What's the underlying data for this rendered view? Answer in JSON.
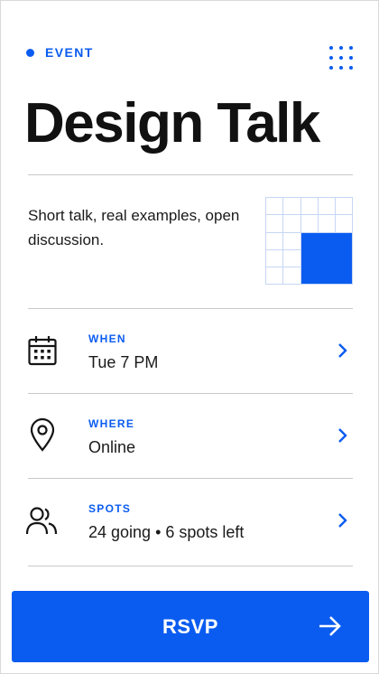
{
  "header": {
    "tag_label": "EVENT",
    "menu_icon": "grid-dots-icon"
  },
  "title": "Design Talk",
  "description": "Short talk, real examples, open discussion.",
  "details": [
    {
      "label": "WHEN",
      "value": "Tue 7 PM",
      "icon": "calendar-icon"
    },
    {
      "label": "WHERE",
      "value": "Online",
      "icon": "location-pin-icon"
    },
    {
      "label": "SPOTS",
      "value": "24 going • 6 spots left",
      "icon": "people-icon"
    }
  ],
  "cta": {
    "label": "RSVP",
    "icon": "arrow-right-icon"
  },
  "colors": {
    "accent": "#0a5cf0",
    "text": "#141414",
    "divider": "#c9c9c9"
  }
}
